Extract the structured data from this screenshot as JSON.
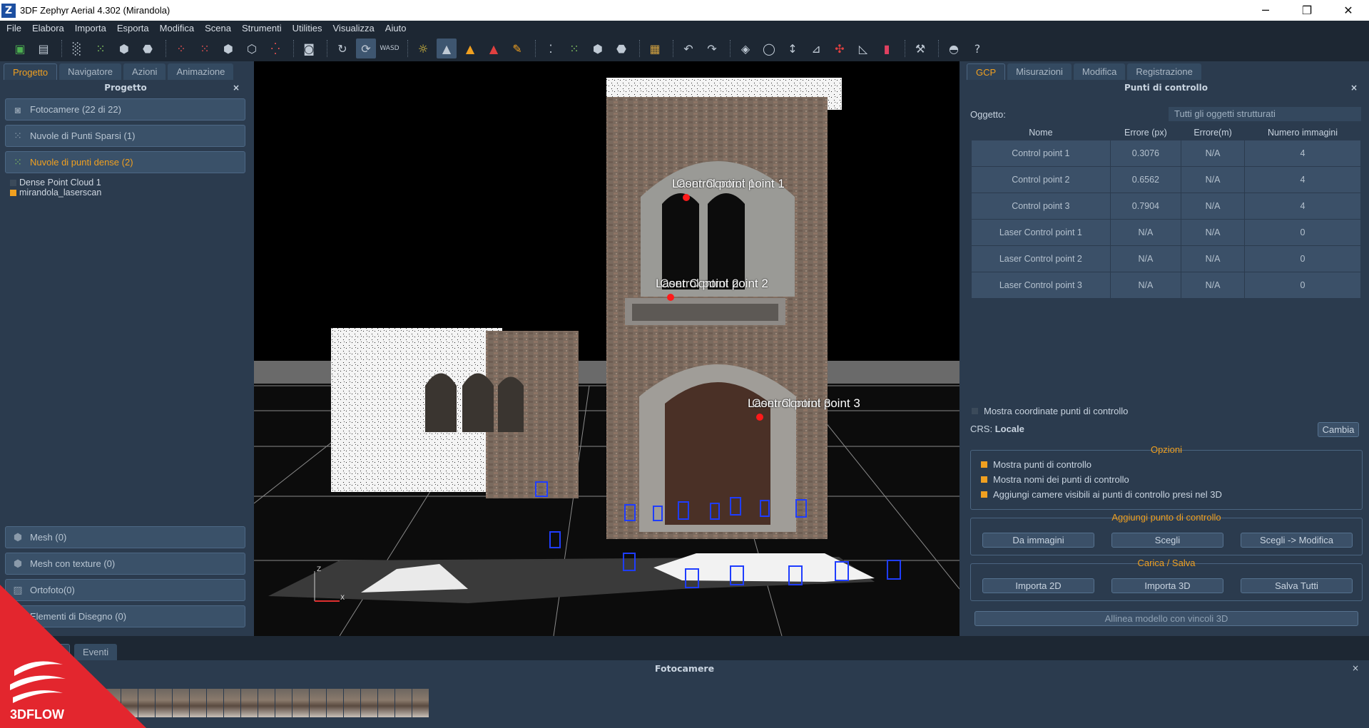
{
  "window": {
    "title": "3DF Zephyr Aerial 4.302 (Mirandola)",
    "app_icon": "Z",
    "minimize": "─",
    "restore": "❐",
    "close": "✕"
  },
  "menu": [
    "File",
    "Elabora",
    "Importa",
    "Esporta",
    "Modifica",
    "Scena",
    "Strumenti",
    "Utilities",
    "Visualizza",
    "Aiuto"
  ],
  "left_panel": {
    "tabs": [
      "Progetto",
      "Navigatore",
      "Azioni",
      "Animazione"
    ],
    "header": "Progetto",
    "close": "×",
    "sections_top": [
      {
        "label": "Fotocamere (22 di 22)",
        "icon": "camera-icon"
      },
      {
        "label": "Nuvole di Punti Sparsi (1)",
        "icon": "sparse-cloud-icon"
      },
      {
        "label": "Nuvole di punti dense (2)",
        "icon": "dense-cloud-icon"
      }
    ],
    "tree": [
      {
        "label": "Dense Point Cloud 1",
        "checked": false
      },
      {
        "label": "mirandola_laserscan",
        "checked": true
      }
    ],
    "sections_bottom": [
      {
        "label": "Mesh (0)",
        "icon": "mesh-icon"
      },
      {
        "label": "Mesh con texture (0)",
        "icon": "textured-mesh-icon"
      },
      {
        "label": "Ortofoto(0)",
        "icon": "orthophoto-icon"
      },
      {
        "label": "Elementi di Disegno (0)",
        "icon": "drawing-icon"
      }
    ]
  },
  "viewport": {
    "labels": [
      "Laser Control point 1",
      "Laser Control point 2",
      "Laser Control point 3"
    ],
    "overlap_labels": [
      "Control point 1",
      "Control point 2",
      "Control point 3"
    ],
    "axis_z": "Z",
    "axis_x": "X"
  },
  "right_panel": {
    "tabs": [
      "GCP",
      "Misurazioni",
      "Modifica",
      "Registrazione"
    ],
    "header": "Punti di controllo",
    "close": "×",
    "object_label": "Oggetto:",
    "object_value": "Tutti gli oggetti strutturati",
    "table": {
      "columns": [
        "Nome",
        "Errore (px)",
        "Errore(m)",
        "Numero immagini"
      ],
      "rows": [
        [
          "Control point 1",
          "0.3076",
          "N/A",
          "4"
        ],
        [
          "Control point 2",
          "0.6562",
          "N/A",
          "4"
        ],
        [
          "Control point 3",
          "0.7904",
          "N/A",
          "4"
        ],
        [
          "Laser Control point 1",
          "N/A",
          "N/A",
          "0"
        ],
        [
          "Laser Control point 2",
          "N/A",
          "N/A",
          "0"
        ],
        [
          "Laser Control point 3",
          "N/A",
          "N/A",
          "0"
        ]
      ]
    },
    "show_coords": "Mostra coordinate punti di controllo",
    "crs_label": "CRS:",
    "crs_value": "Locale",
    "change_button": "Cambia",
    "options_title": "Opzioni",
    "options": [
      "Mostra punti di controllo",
      "Mostra nomi dei punti di controllo",
      "Aggiungi camere visibili ai punti di controllo presi nel 3D"
    ],
    "add_title": "Aggiungi punto di controllo",
    "add_buttons": [
      "Da immagini",
      "Scegli",
      "Scegli -> Modifica"
    ],
    "load_title": "Carica / Salva",
    "load_buttons": [
      "Importa 2D",
      "Importa 3D",
      "Salva Tutti"
    ],
    "align_button": "Allinea modello con vincoli 3D"
  },
  "bottom": {
    "tabs": [
      "Log",
      "Eventi"
    ],
    "panel_title": "Fotocamere",
    "close": "×"
  },
  "logo": {
    "text": "3DFLOW"
  },
  "colors": {
    "accent": "#f0a020",
    "panel": "#2b3b4e",
    "control_point": "#ff1a1a",
    "camera_frustum": "#1f3dff"
  }
}
